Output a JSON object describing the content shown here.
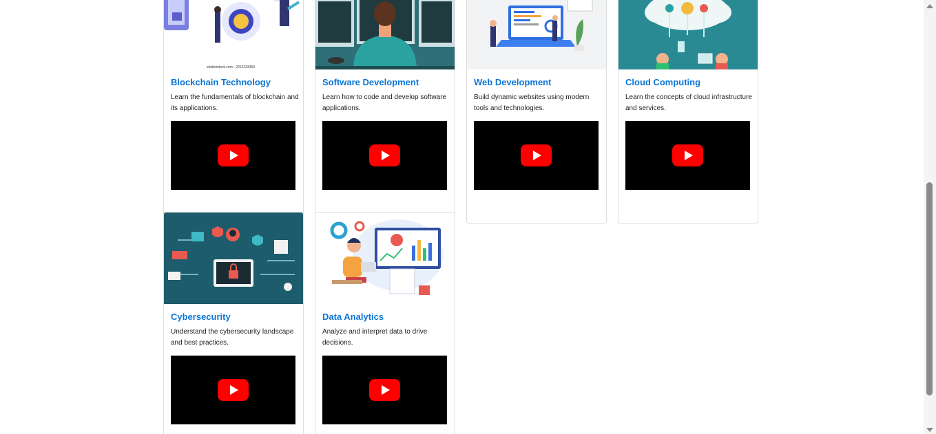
{
  "courses": [
    {
      "title": "Blockchain Technology",
      "description": "Learn the fundamentals of blockchain and its applications.",
      "thumbnail_caption": "shutterstock.com · 2262233369",
      "thumbnail_icon": "blockchain-illustration-icon"
    },
    {
      "title": "Software Development",
      "description": "Learn how to code and develop software applications.",
      "thumbnail_icon": "developer-at-monitors-icon"
    },
    {
      "title": "Web Development",
      "description": "Build dynamic websites using modern tools and technologies.",
      "thumbnail_icon": "laptop-code-icon"
    },
    {
      "title": "Cloud Computing",
      "description": "Learn the concepts of cloud infrastructure and services.",
      "thumbnail_icon": "cloud-network-icon"
    },
    {
      "title": "Cybersecurity",
      "description": "Understand the cybersecurity landscape and best practices.",
      "thumbnail_icon": "security-lock-icon"
    },
    {
      "title": "Data Analytics",
      "description": "Analyze and interpret data to drive decisions.",
      "thumbnail_icon": "analytics-dashboard-icon"
    }
  ],
  "colors": {
    "title_link": "#0b75d6",
    "play_button": "#ff0000",
    "video_bg": "#000000"
  }
}
